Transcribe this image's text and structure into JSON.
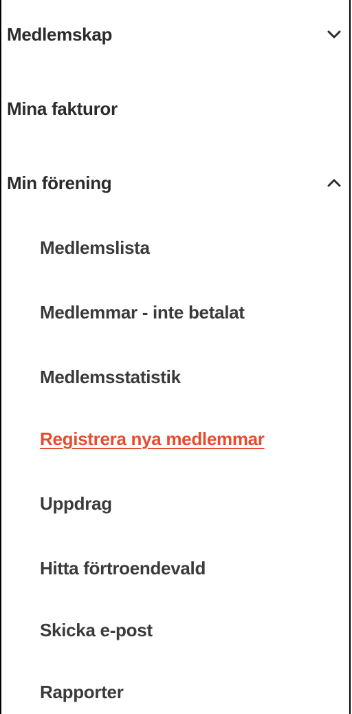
{
  "menu": {
    "items": [
      {
        "label": "Medlemskap",
        "expandable": true,
        "expanded": false,
        "icon": "chevron-down-icon"
      },
      {
        "label": "Mina fakturor",
        "expandable": false
      },
      {
        "label": "Min förening",
        "expandable": true,
        "expanded": true,
        "icon": "chevron-up-icon"
      }
    ],
    "sub_items": [
      {
        "label": "Medlemslista",
        "active": false
      },
      {
        "label": "Medlemmar - inte betalat",
        "active": false
      },
      {
        "label": "Medlemsstatistik",
        "active": false
      },
      {
        "label": "Registrera nya medlemmar",
        "active": true
      },
      {
        "label": "Uppdrag",
        "active": false
      },
      {
        "label": "Hitta förtroendevald",
        "active": false
      },
      {
        "label": "Skicka e-post",
        "active": false
      },
      {
        "label": "Rapporter",
        "active": false
      }
    ]
  },
  "colors": {
    "text": "#2b2b2b",
    "subtext": "#3a3a3a",
    "active": "#e84b2f",
    "border": "#000000"
  }
}
